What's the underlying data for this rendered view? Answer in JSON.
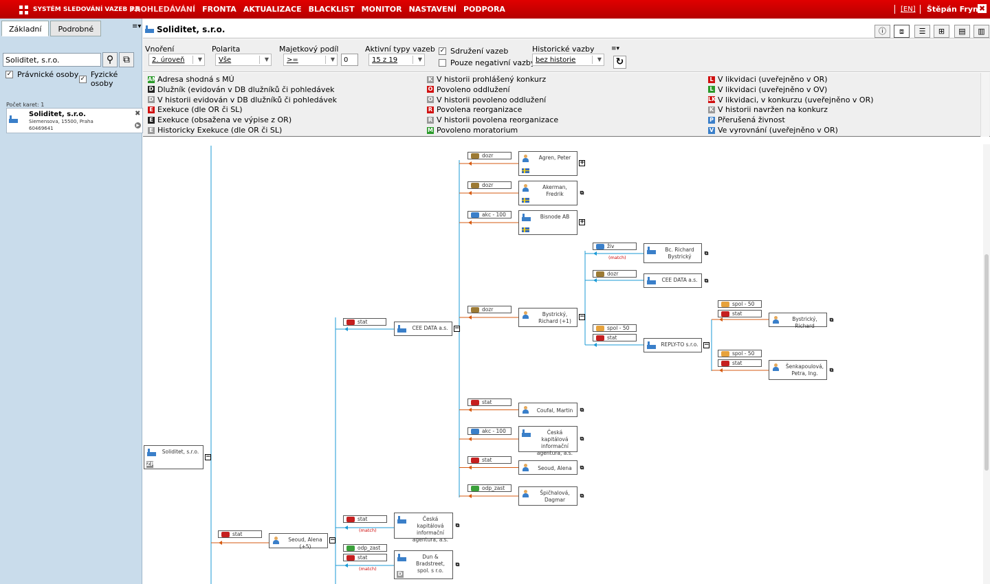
{
  "header": {
    "app_title": "SYSTÉM SLEDOVÁNÍ VAZEB 8.5",
    "menu": [
      "PROHLEDÁVÁNÍ",
      "FRONTA",
      "AKTUALIZACE",
      "BLACKLIST",
      "MONITOR",
      "NASTAVENÍ",
      "PODPORA"
    ],
    "lang": "[EN]",
    "user": "Štěpán Frynta",
    "close": "✖"
  },
  "left": {
    "tabs": [
      "Základní",
      "Podrobné"
    ],
    "search_value": "Soliditet, s.r.o.",
    "cb_legal": "Právnické osoby",
    "cb_natural": "Fyzické osoby",
    "count": "Počet karet: 1",
    "card": {
      "name": "Soliditet, s.r.o.",
      "address": "Siemensova, 15500, Praha",
      "id": "60469641"
    }
  },
  "title": {
    "subject": "Soliditet, s.r.o."
  },
  "filters": {
    "depth_label": "Vnoření",
    "depth_value": "2. úroveň",
    "polarity_label": "Polarita",
    "polarity_value": "Vše",
    "share_label": "Majetkový podíl",
    "share_op": ">=",
    "share_value": "0",
    "types_label": "Aktivní typy vazeb",
    "types_value": "15 z 19",
    "group_label": "Sdružení vazeb",
    "negative_label": "Pouze negativní vazby",
    "history_label": "Historické vazby",
    "history_value": "bez historie"
  },
  "legend": {
    "col1": [
      {
        "icon": "AM",
        "color": "#2a9a2a",
        "text": "Adresa shodná s MÚ"
      },
      {
        "icon": "D",
        "color": "#222",
        "text": "Dlužník (evidován v DB dlužníků či pohledávek"
      },
      {
        "icon": "D",
        "color": "#999",
        "text": "V historii evidován v DB dlužníků či pohledávek"
      },
      {
        "icon": "E",
        "color": "#d01010",
        "text": "Exekuce (dle OR či SL)"
      },
      {
        "icon": "E",
        "color": "#222",
        "text": "Exekuce (obsažena ve výpise z OR)"
      },
      {
        "icon": "E",
        "color": "#999",
        "text": "Historicky Exekuce (dle OR či SL)"
      }
    ],
    "col2": [
      {
        "icon": "K",
        "color": "#999",
        "text": "V historii prohlášený konkurz"
      },
      {
        "icon": "O",
        "color": "#d01010",
        "text": "Povoleno oddlužení"
      },
      {
        "icon": "O",
        "color": "#999",
        "text": "V historii povoleno oddlužení"
      },
      {
        "icon": "R",
        "color": "#d01010",
        "text": "Povolena reorganizace"
      },
      {
        "icon": "R",
        "color": "#999",
        "text": "V historii povolena reorganizace"
      },
      {
        "icon": "M",
        "color": "#2a9a2a",
        "text": "Povoleno moratorium"
      }
    ],
    "col3": [
      {
        "icon": "L",
        "color": "#d01010",
        "text": "V likvidaci (uveřejněno v OR)"
      },
      {
        "icon": "L",
        "color": "#2a9a2a",
        "text": "V likvidaci (uveřejněno v OV)"
      },
      {
        "icon": "LK",
        "color": "#d01010",
        "text": "V likvidaci, v konkurzu (uveřejněno v OR)"
      },
      {
        "icon": "K",
        "color": "#999",
        "text": "V historii navržen na konkurz"
      },
      {
        "icon": "P",
        "color": "#3a7fc9",
        "text": "Přerušená živnost"
      },
      {
        "icon": "V",
        "color": "#3a7fc9",
        "text": "Ve vyrovnání (uveřejněno v OR)"
      }
    ]
  },
  "graph": {
    "nodes": [
      {
        "id": "root",
        "label": "Soliditet, s.r.o.",
        "kind": "co"
      },
      {
        "id": "n_agren",
        "label": "Agren, Peter",
        "kind": "pe"
      },
      {
        "id": "n_akerman",
        "label": "Akerman, Fredrik",
        "kind": "pe"
      },
      {
        "id": "n_bisnode",
        "label": "Bisnode AB",
        "kind": "co"
      },
      {
        "id": "n_bystricky_bc",
        "label": "Bc. Richard Bystrický",
        "kind": "co"
      },
      {
        "id": "n_cee2",
        "label": "CEE DATA a.s.",
        "kind": "co"
      },
      {
        "id": "n_bystricky_r",
        "label": "Bystrický, Richard (+1)",
        "kind": "pe"
      },
      {
        "id": "n_bystricky_r2",
        "label": "Bystrický, Richard",
        "kind": "pe"
      },
      {
        "id": "n_cee",
        "label": "CEE DATA a.s.",
        "kind": "co"
      },
      {
        "id": "n_reply",
        "label": "REPLY-TO s.r.o.",
        "kind": "co"
      },
      {
        "id": "n_senk",
        "label": "Šenkapoulová, Petra, Ing.",
        "kind": "pe"
      },
      {
        "id": "n_coufal",
        "label": "Coufal, Martin",
        "kind": "pe"
      },
      {
        "id": "n_cka",
        "label": "Česká kapitálová informační agentura, a.s.",
        "kind": "co"
      },
      {
        "id": "n_seoud",
        "label": "Seoud, Alena",
        "kind": "pe"
      },
      {
        "id": "n_spic",
        "label": "Špičhalová, Dagmar",
        "kind": "pe"
      },
      {
        "id": "n_seoud5",
        "label": "Seoud, Alena (+5)",
        "kind": "pe"
      },
      {
        "id": "n_cka2",
        "label": "Česká kapitálová informační agentura, a.s.",
        "kind": "co"
      },
      {
        "id": "n_dun",
        "label": "Dun & Bradstreet, spol. s r.o.",
        "kind": "co"
      }
    ],
    "relations": {
      "dozr": "dozr",
      "akc100": "akc - 100",
      "zivn": "živ",
      "stat": "stat",
      "spol50": "spol - 50",
      "odp_zast": "odp_zast",
      "match": "(match)"
    }
  },
  "colors": {
    "accent": "#d00000",
    "edge_blue": "#1a9ad6",
    "edge_orange": "#d65a10",
    "panel": "#c9dceb"
  }
}
